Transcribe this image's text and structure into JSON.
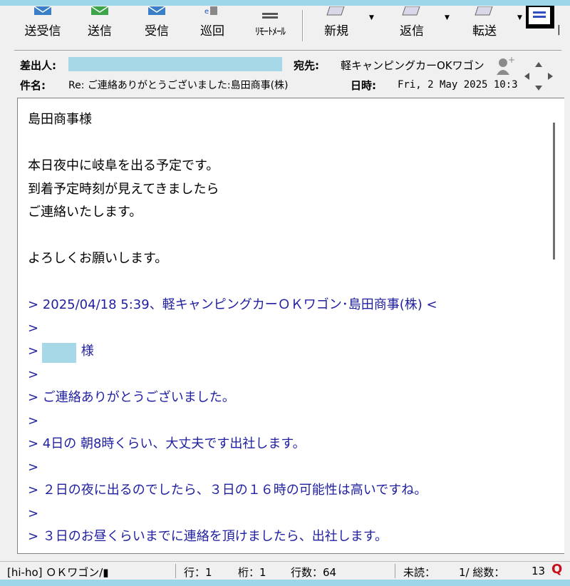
{
  "toolbar": {
    "send_receive": "送受信",
    "send": "送信",
    "receive": "受信",
    "patrol": "巡回",
    "remote_mail": "ﾘﾓｰﾄﾒｰﾙ",
    "new": "新規",
    "reply": "返信",
    "forward": "転送"
  },
  "header": {
    "from_label": "差出人:",
    "to_label": "宛先:",
    "to_value": "軽キャンピングカーOKワゴン",
    "subject_label": "件名:",
    "subject_value": "Re: ご連絡ありがとうございました:島田商事(株)",
    "date_label": "日時:",
    "date_value": "Fri, 2 May 2025 10:3"
  },
  "message": {
    "lines": [
      {
        "text": "島田商事様",
        "quote": false
      },
      {
        "text": "",
        "quote": false
      },
      {
        "text": "本日夜中に岐阜を出る予定です。",
        "quote": false
      },
      {
        "text": "到着予定時刻が見えてきましたら",
        "quote": false
      },
      {
        "text": "ご連絡いたします。",
        "quote": false
      },
      {
        "text": "",
        "quote": false
      },
      {
        "text": "よろしくお願いします。",
        "quote": false
      },
      {
        "text": "",
        "quote": false
      },
      {
        "text": "> 2025/04/18 5:39、軽キャンピングカーＯＫワゴン･島田商事(株) <",
        "quote": true
      },
      {
        "text": ">",
        "quote": true
      },
      {
        "text": "> 　　　様",
        "quote": true
      },
      {
        "text": ">",
        "quote": true
      },
      {
        "text": "> ご連絡ありがとうございました。",
        "quote": true
      },
      {
        "text": ">",
        "quote": true
      },
      {
        "text": "> 4日の 朝8時くらい、大丈夫です出社します。",
        "quote": true
      },
      {
        "text": ">",
        "quote": true
      },
      {
        "text": "> ２日の夜に出るのでしたら、３日の１６時の可能性は高いですね。",
        "quote": true
      },
      {
        "text": ">",
        "quote": true
      },
      {
        "text": "> ３日のお昼くらいまでに連絡を頂けましたら、出社します。",
        "quote": true
      }
    ]
  },
  "status": {
    "account": "[hi-ho] ＯＫワゴン/▮",
    "row": "行：1",
    "col": "桁：1",
    "lines": "行数：64",
    "unread": "未読：",
    "counts": "1/ 総数：",
    "total": "13"
  },
  "colors": {
    "quote_text": "#1f1fa0",
    "redaction": "#a6d8e8",
    "accent": "#c8101a"
  }
}
